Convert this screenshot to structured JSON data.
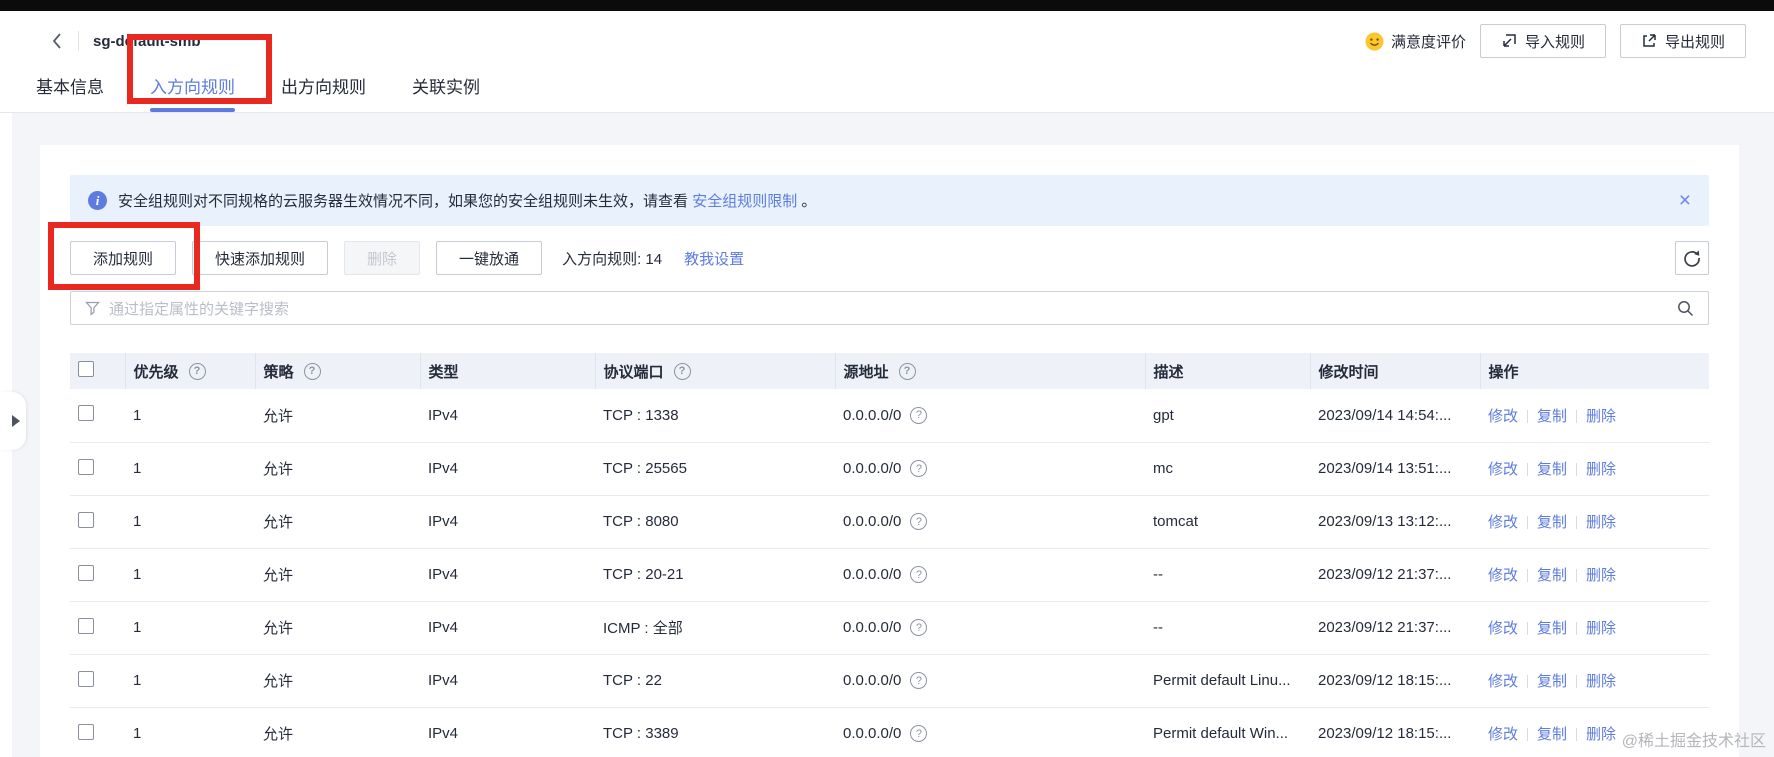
{
  "header": {
    "title": "sg-default-smb",
    "satisfaction_label": "满意度评价",
    "import_label": "导入规则",
    "export_label": "导出规则"
  },
  "tabs": [
    {
      "label": "基本信息",
      "active": false
    },
    {
      "label": "入方向规则",
      "active": true
    },
    {
      "label": "出方向规则",
      "active": false
    },
    {
      "label": "关联实例",
      "active": false
    }
  ],
  "banner": {
    "text": "安全组规则对不同规格的云服务器生效情况不同，如果您的安全组规则未生效，请查看",
    "link": "安全组规则限制",
    "suffix": "。"
  },
  "toolbar": {
    "add": "添加规则",
    "quick_add": "快速添加规则",
    "delete": "删除",
    "allow_all": "一键放通",
    "count_label": "入方向规则: 14",
    "teach_link": "教我设置"
  },
  "search": {
    "placeholder": "通过指定属性的关键字搜索"
  },
  "table": {
    "columns": [
      {
        "label": "优先级",
        "help": true
      },
      {
        "label": "策略",
        "help": true
      },
      {
        "label": "类型",
        "help": false
      },
      {
        "label": "协议端口",
        "help": true
      },
      {
        "label": "源地址",
        "help": true
      },
      {
        "label": "描述",
        "help": false
      },
      {
        "label": "修改时间",
        "help": false
      },
      {
        "label": "操作",
        "help": false
      }
    ],
    "rows": [
      {
        "priority": "1",
        "policy": "允许",
        "type": "IPv4",
        "protocol": "TCP : 1338",
        "source": "0.0.0.0/0",
        "description": "gpt",
        "modified": "2023/09/14 14:54:..."
      },
      {
        "priority": "1",
        "policy": "允许",
        "type": "IPv4",
        "protocol": "TCP : 25565",
        "source": "0.0.0.0/0",
        "description": "mc",
        "modified": "2023/09/14 13:51:..."
      },
      {
        "priority": "1",
        "policy": "允许",
        "type": "IPv4",
        "protocol": "TCP : 8080",
        "source": "0.0.0.0/0",
        "description": "tomcat",
        "modified": "2023/09/13 13:12:..."
      },
      {
        "priority": "1",
        "policy": "允许",
        "type": "IPv4",
        "protocol": "TCP : 20-21",
        "source": "0.0.0.0/0",
        "description": "--",
        "modified": "2023/09/12 21:37:..."
      },
      {
        "priority": "1",
        "policy": "允许",
        "type": "IPv4",
        "protocol": "ICMP : 全部",
        "source": "0.0.0.0/0",
        "description": "--",
        "modified": "2023/09/12 21:37:..."
      },
      {
        "priority": "1",
        "policy": "允许",
        "type": "IPv4",
        "protocol": "TCP : 22",
        "source": "0.0.0.0/0",
        "description": "Permit default Linu...",
        "modified": "2023/09/12 18:15:..."
      },
      {
        "priority": "1",
        "policy": "允许",
        "type": "IPv4",
        "protocol": "TCP : 3389",
        "source": "0.0.0.0/0",
        "description": "Permit default Win...",
        "modified": "2023/09/12 18:15:..."
      }
    ],
    "actions": [
      "修改",
      "复制",
      "删除"
    ]
  },
  "watermark": "@稀土掘金技术社区",
  "colors": {
    "accent": "#5e7ce0",
    "annotation": "#e9291f",
    "banner_bg": "#e8f1fc"
  }
}
